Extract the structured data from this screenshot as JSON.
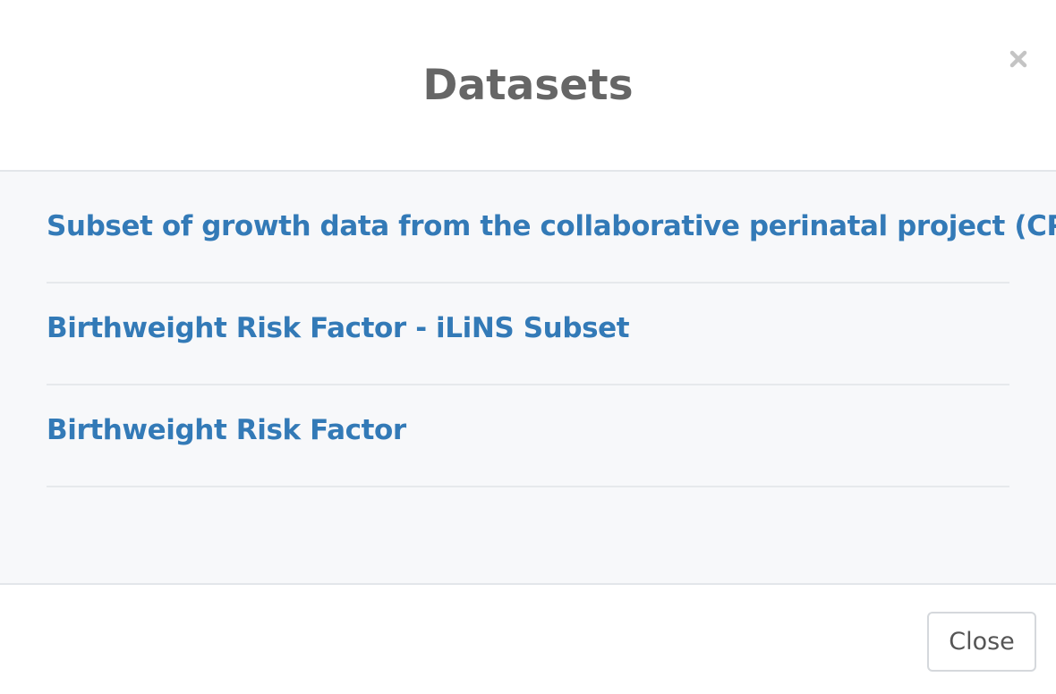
{
  "dialog": {
    "title": "Datasets",
    "close_icon": "close-x-icon",
    "close_button_label": "Close"
  },
  "datasets": [
    {
      "label": "Subset of growth data from the collaborative perinatal project (CPP)"
    },
    {
      "label": "Birthweight Risk Factor - iLiNS Subset"
    },
    {
      "label": "Birthweight Risk Factor"
    }
  ],
  "colors": {
    "link": "#337ab7",
    "title": "#666666",
    "body_background": "#f7f8fa",
    "divider": "#e3e6ea"
  }
}
